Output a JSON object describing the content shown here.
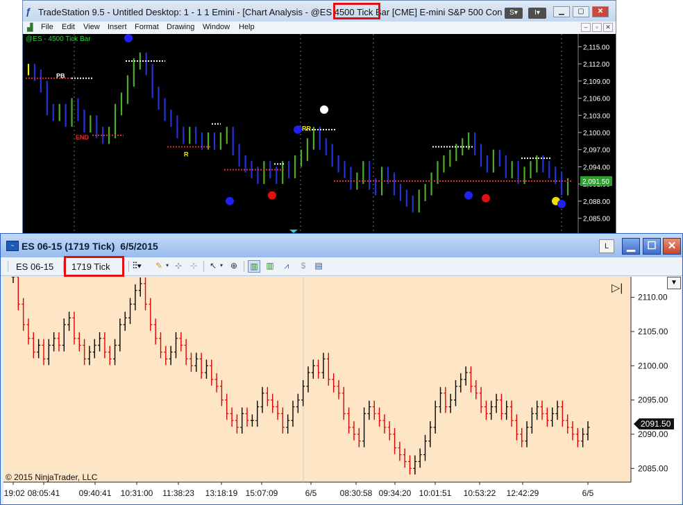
{
  "tradestation": {
    "title": "TradeStation 9.5 - Untitled Desktop: 1 - 1 1 Emini - [Chart Analysis - @ES 4500 Tick Bar [CME] E-mini S&P 500 Con",
    "title_buttons": [
      "S",
      "I"
    ],
    "menu": [
      "File",
      "Edit",
      "View",
      "Insert",
      "Format",
      "Drawing",
      "Window",
      "Help"
    ],
    "symbol_label": "@ES - 4500 Tick Bar",
    "highlight_text": "4500 Tick Bar",
    "markers": [
      "PB",
      "END",
      "R",
      "RR"
    ],
    "price_ticks": [
      "2,115.00",
      "2,112.00",
      "2,109.00",
      "2,106.00",
      "2,103.00",
      "2,100.00",
      "2,097.00",
      "2,094.00",
      "2,091.00",
      "2,088.00",
      "2,085.00"
    ],
    "last_price": "2,091.50",
    "colors": {
      "background": "#000000",
      "up_bar": "#4caf2a",
      "down_bar": "#2234d8",
      "neutral_bar": "#f0f000",
      "axis_text": "#ffffff",
      "last_price_bg": "#2ca02c"
    }
  },
  "ninjatrader": {
    "title_symbol": "ES 06-15",
    "title_interval": "(1719 Tick)",
    "title_date": "6/5/2015",
    "layout_button": "L",
    "toolbar": {
      "instrument": "ES 06-15",
      "interval": "1719 Tick"
    },
    "price_ticks": [
      "2110.00",
      "2105.00",
      "2100.00",
      "2095.00",
      "2090.00",
      "2085.00"
    ],
    "last_price": "2091.50",
    "time_ticks": [
      ":19:02",
      "08:05:41",
      "09:40:41",
      "10:31:00",
      "11:38:23",
      "13:18:19",
      "15:07:09",
      "6/5",
      "08:30:58",
      "09:34:20",
      "10:01:51",
      "10:53:22",
      "12:42:29",
      "6/5"
    ],
    "copyright": "© 2015 NinjaTrader, LLC",
    "colors": {
      "background": "#fde5c6",
      "up_bar": "#000000",
      "down_bar": "#e00000",
      "last_price_bg": "#111111"
    }
  },
  "chart_data": [
    {
      "type": "ohlc",
      "title": "@ES - 4500 Tick Bar",
      "ylim": [
        2083.5,
        2116.5
      ],
      "y_ticks": [
        2115,
        2112,
        2109,
        2106,
        2103,
        2100,
        2097,
        2094,
        2091,
        2088,
        2085
      ],
      "series": [
        {
          "values": [
            2111,
            2110,
            2108,
            2104,
            2103,
            2104,
            2102,
            2105,
            2103,
            2101,
            2102,
            2100,
            2099,
            2100,
            2104,
            2106,
            2109,
            2112,
            2113,
            2111,
            2107,
            2105,
            2103,
            2102,
            2100,
            2099,
            2100,
            2099,
            2098,
            2099,
            2098,
            2099,
            2100,
            2097,
            2095,
            2094,
            2093,
            2092,
            2094,
            2093,
            2092,
            2094,
            2093,
            2095,
            2096,
            2098,
            2100,
            2098,
            2097,
            2095,
            2094,
            2093,
            2091,
            2092,
            2094,
            2091,
            2090,
            2093,
            2092,
            2090,
            2089,
            2088,
            2087,
            2089,
            2090,
            2092,
            2094,
            2095,
            2096,
            2097,
            2098,
            2099,
            2097,
            2095,
            2094,
            2096,
            2095,
            2093,
            2094,
            2092,
            2093,
            2094,
            2095,
            2094,
            2093,
            2092,
            2090,
            2091
          ]
        }
      ]
    },
    {
      "type": "ohlc",
      "title": "ES 06-15 (1719 Tick) 6/5/2015",
      "ylim": [
        2083.0,
        2113.0
      ],
      "y_ticks": [
        2110,
        2105,
        2100,
        2095,
        2090,
        2085
      ],
      "x_ticks": [
        ":19:02",
        "08:05:41",
        "09:40:41",
        "10:31:00",
        "11:38:23",
        "13:18:19",
        "15:07:09",
        "6/5",
        "08:30:58",
        "09:34:20",
        "10:01:51",
        "10:53:22",
        "12:42:29",
        "6/5"
      ],
      "series": [
        {
          "values": [
            2113,
            2109,
            2106,
            2104,
            2102,
            2103,
            2101,
            2103,
            2104,
            2103,
            2106,
            2107,
            2104,
            2103,
            2101,
            2102,
            2103,
            2104,
            2102,
            2101,
            2103,
            2106,
            2107,
            2109,
            2111,
            2112,
            2109,
            2106,
            2104,
            2102,
            2101,
            2102,
            2104,
            2103,
            2101,
            2100,
            2101,
            2099,
            2100,
            2098,
            2097,
            2095,
            2093,
            2092,
            2091,
            2093,
            2092,
            2092,
            2094,
            2096,
            2095,
            2094,
            2093,
            2091,
            2092,
            2094,
            2095,
            2097,
            2099,
            2100,
            2099,
            2101,
            2098,
            2097,
            2096,
            2093,
            2091,
            2090,
            2089,
            2093,
            2094,
            2093,
            2092,
            2091,
            2090,
            2088,
            2087,
            2086,
            2085,
            2086,
            2087,
            2089,
            2091,
            2094,
            2096,
            2094,
            2095,
            2097,
            2098,
            2099,
            2097,
            2096,
            2094,
            2093,
            2094,
            2095,
            2093,
            2094,
            2092,
            2090,
            2089,
            2091,
            2093,
            2094,
            2093,
            2092,
            2093,
            2094,
            2092,
            2091,
            2090,
            2089,
            2090,
            2091
          ]
        }
      ]
    }
  ]
}
